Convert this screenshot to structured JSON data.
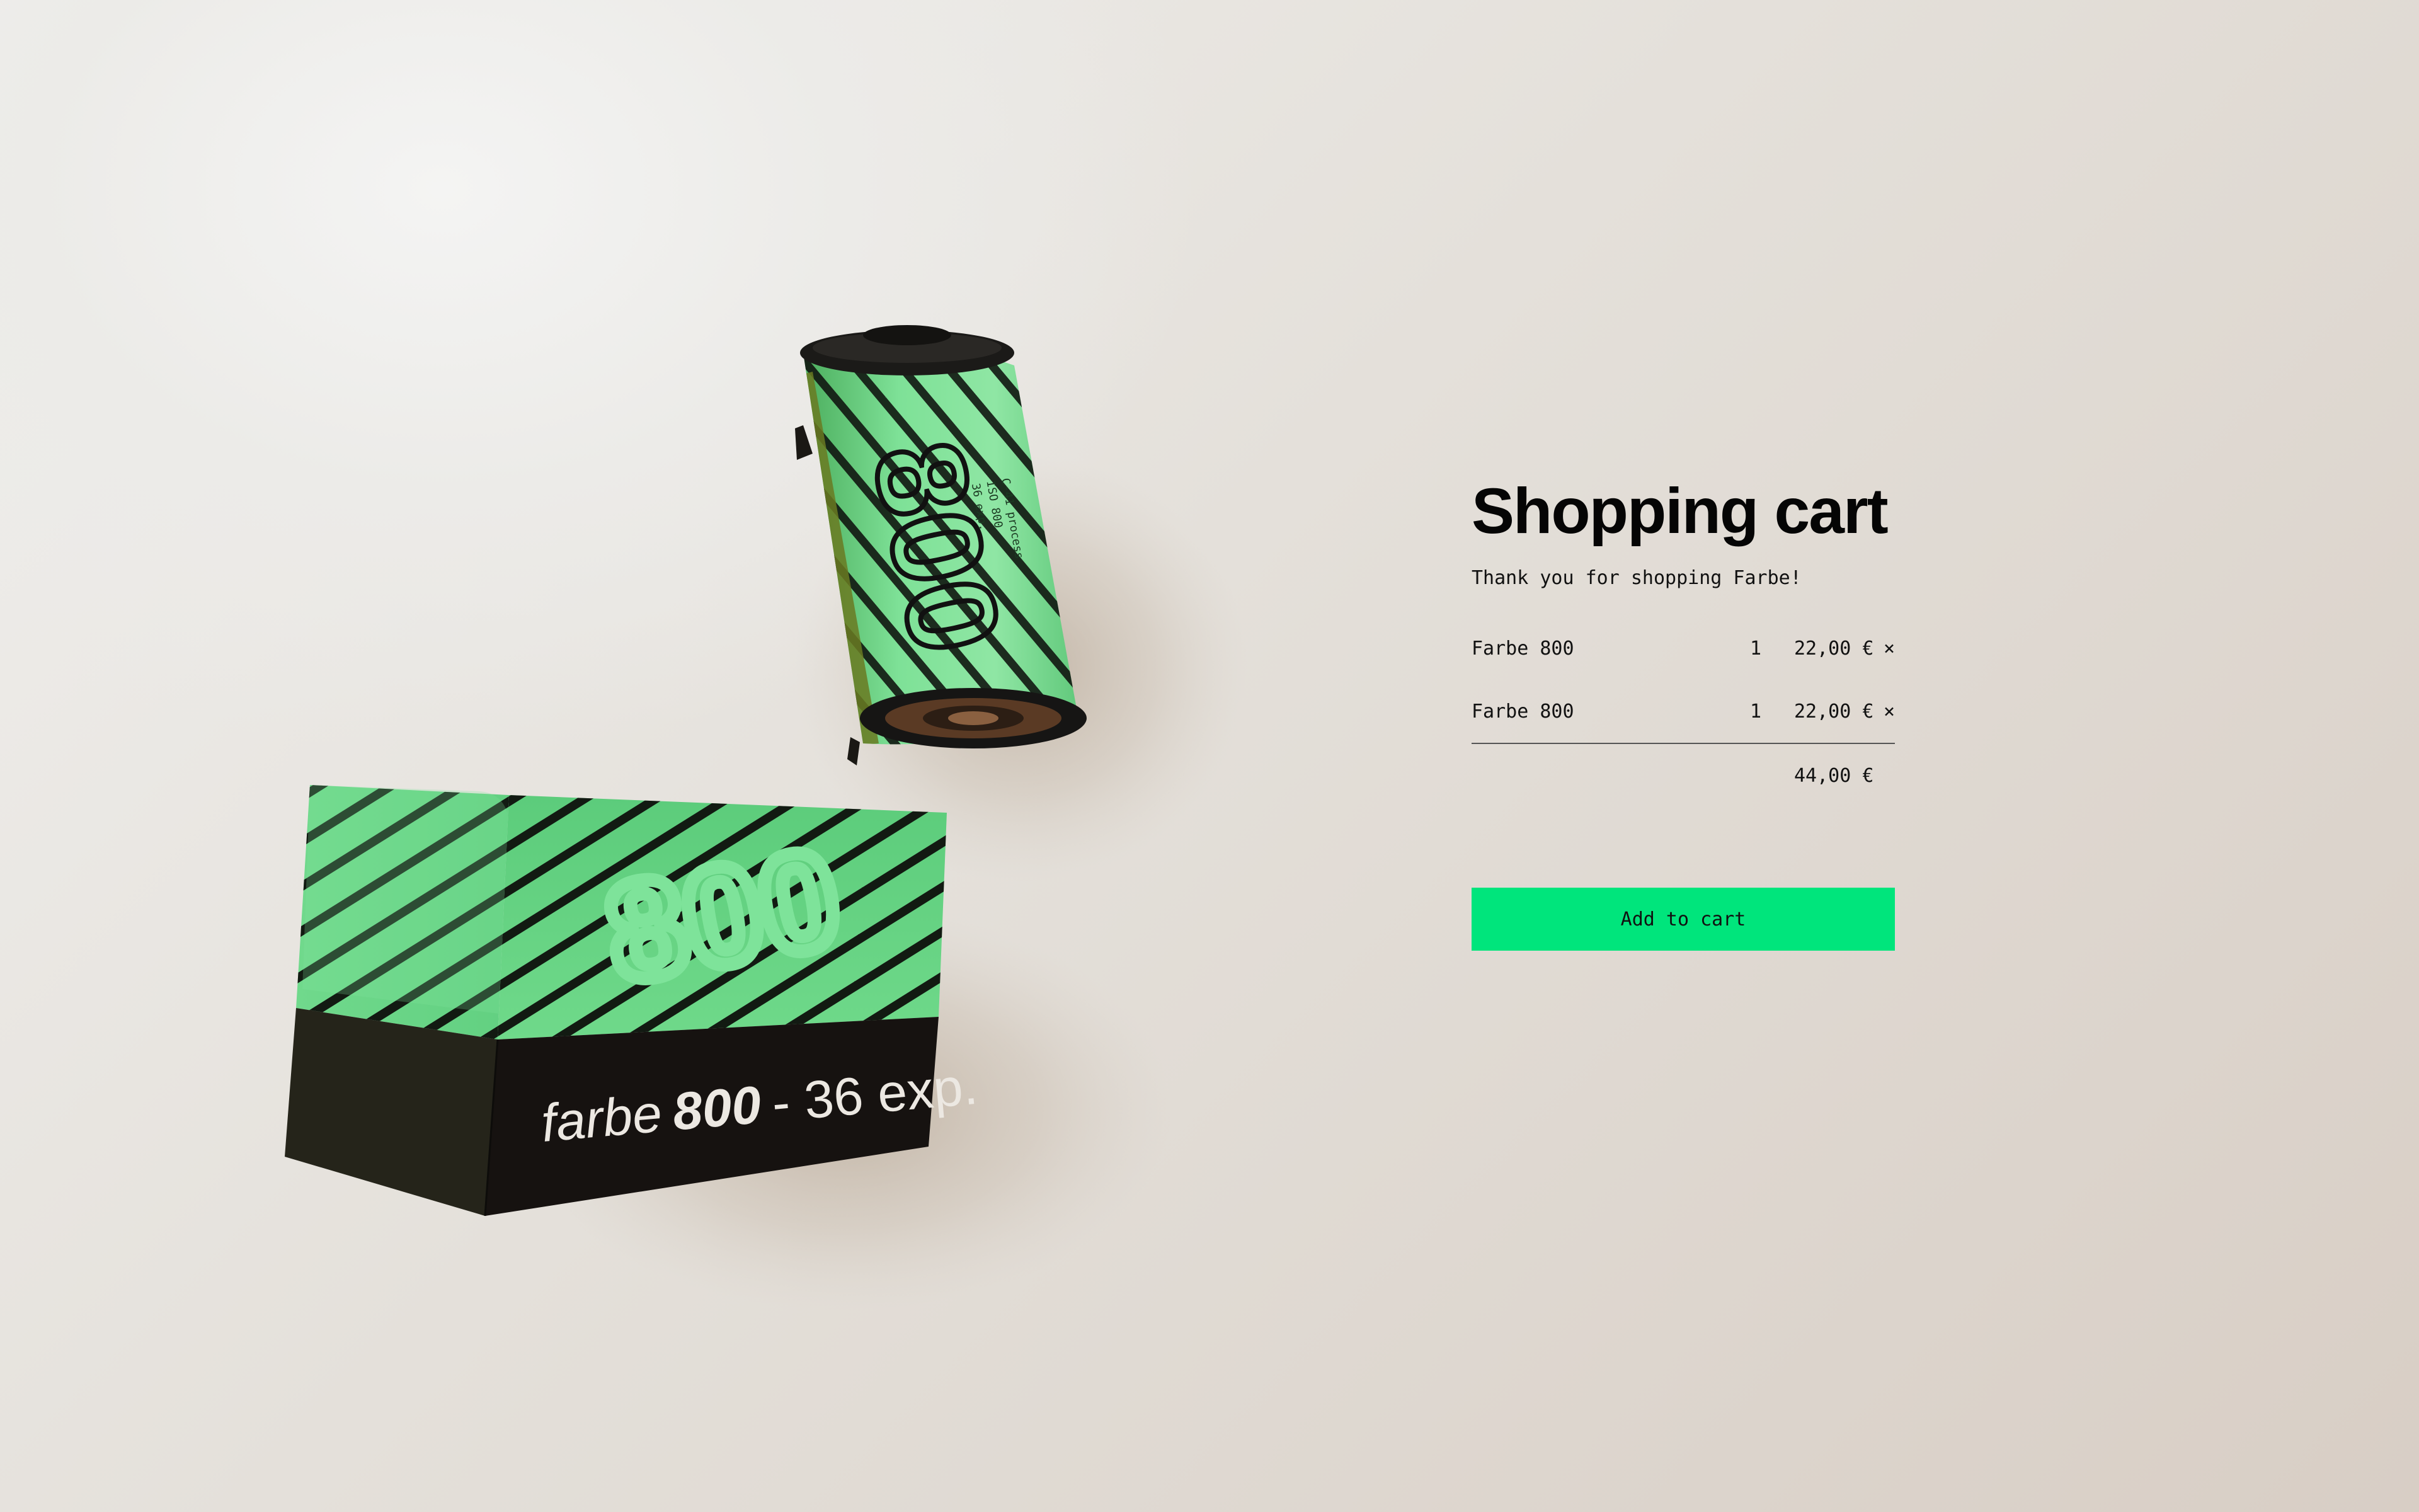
{
  "cart": {
    "title": "Shopping cart",
    "subtitle": "Thank you for shopping Farbe!",
    "items": [
      {
        "name": "Farbe 800",
        "quantity": "1",
        "price": "22,00 €",
        "remove_symbol": "×"
      },
      {
        "name": "Farbe 800",
        "quantity": "1",
        "price": "22,00 €",
        "remove_symbol": "×"
      }
    ],
    "total": "44,00 €",
    "add_to_cart_label": "Add to cart"
  },
  "product_scene": {
    "box_label": "farbe 800 - 36 exp.",
    "box_label_parts": {
      "brand": "farbe",
      "speed": "800",
      "exposures": "- 36 exp."
    },
    "canister_number": "800",
    "box_number": "800"
  },
  "colors": {
    "accent_button": "#00e57c",
    "packaging_green": "#5fd47f",
    "packaging_dark": "#1a1612",
    "background": "#e6e2dc"
  },
  "icons": {
    "remove_item": "close-icon"
  }
}
